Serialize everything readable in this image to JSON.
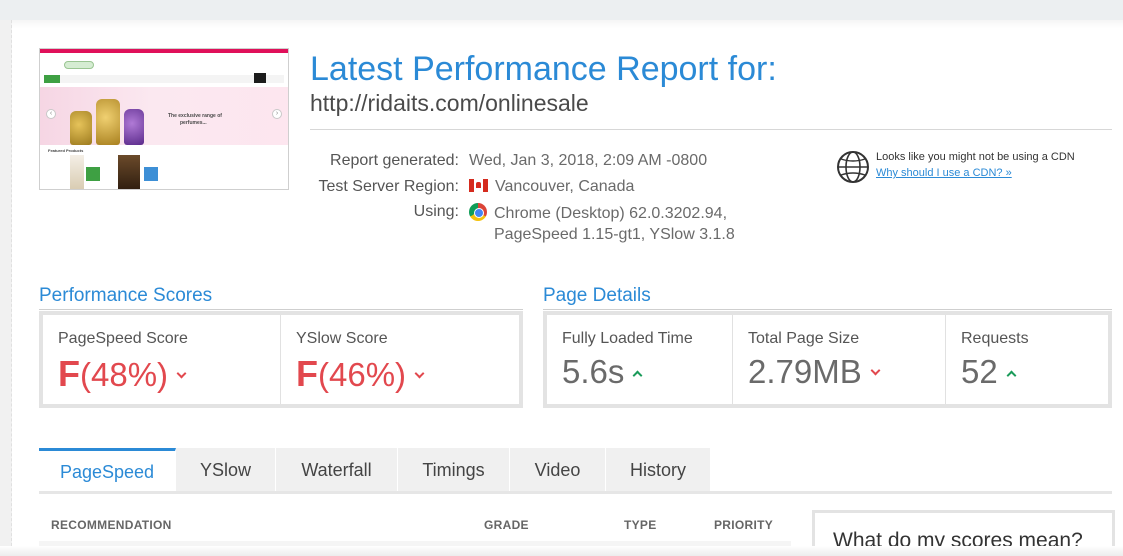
{
  "report": {
    "title": "Latest Performance Report for:",
    "url": "http://ridaits.com/onlinesale"
  },
  "meta": {
    "generated_label": "Report generated:",
    "generated_value": "Wed, Jan 3, 2018, 2:09 AM -0800",
    "region_label": "Test Server Region:",
    "region_value": "Vancouver, Canada",
    "region_flag": "canada-flag-icon",
    "using_label": "Using:",
    "using_value_line1": "Chrome (Desktop) 62.0.3202.94,",
    "using_value_line2": "PageSpeed 1.15-gt1, YSlow 3.1.8",
    "browser_icon": "chrome-icon"
  },
  "cdn": {
    "notice": "Looks like you might not be using a CDN",
    "link": "Why should I use a CDN? »",
    "icon": "globe-icon"
  },
  "thumbnail": {
    "hero_line1": "The exclusive range of",
    "hero_line2": "perfumes...",
    "featured_label": "Featured Products"
  },
  "performance_scores": {
    "heading": "Performance Scores",
    "pagespeed": {
      "label": "PageSpeed Score",
      "grade": "F",
      "value": "(48%)",
      "trend": "down"
    },
    "yslow": {
      "label": "YSlow Score",
      "grade": "F",
      "value": "(46%)",
      "trend": "down"
    }
  },
  "page_details": {
    "heading": "Page Details",
    "fully_loaded": {
      "label": "Fully Loaded Time",
      "value": "5.6s",
      "trend": "up"
    },
    "page_size": {
      "label": "Total Page Size",
      "value": "2.79MB",
      "trend": "down"
    },
    "requests": {
      "label": "Requests",
      "value": "52",
      "trend": "up"
    }
  },
  "tabs": [
    {
      "label": "PageSpeed",
      "active": true
    },
    {
      "label": "YSlow",
      "active": false
    },
    {
      "label": "Waterfall",
      "active": false
    },
    {
      "label": "Timings",
      "active": false
    },
    {
      "label": "Video",
      "active": false
    },
    {
      "label": "History",
      "active": false
    }
  ],
  "table": {
    "headers": [
      "RECOMMENDATION",
      "GRADE",
      "TYPE",
      "PRIORITY"
    ]
  },
  "side_panel": {
    "title": "What do my scores mean?"
  },
  "colors": {
    "accent": "#2b8ad6",
    "bad": "#e2484e",
    "good": "#1a9b5a"
  }
}
